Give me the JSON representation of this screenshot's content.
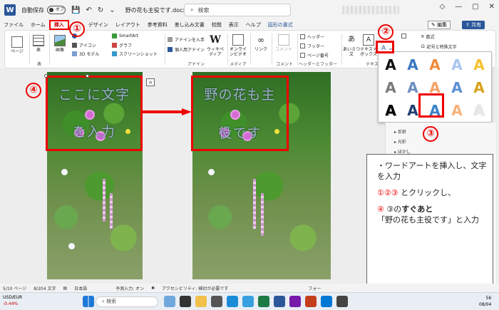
{
  "titlebar": {
    "autosave_label": "自動保存",
    "autosave_state": "オフ",
    "doc_title": "野の花も主役です.docx",
    "search_placeholder": "検索"
  },
  "menu": {
    "items": [
      "ファイル",
      "ホーム",
      "挿入",
      "デザイン",
      "レイアウト",
      "参考資料",
      "差し込み文書",
      "校閲",
      "表示",
      "ヘルプ",
      "図形の書式"
    ],
    "active_index": 2,
    "edit_label": "編集",
    "share_label": "共有"
  },
  "ribbon": {
    "pages": "ページ",
    "table": "表",
    "image": "画像",
    "icon": "アイコン",
    "model3d": "3D モデル",
    "smartart": "SmartArt",
    "graph": "グラフ",
    "screenshot": "スクリーンショット",
    "addin_get": "アドインを入手",
    "personal_addin": "個人用アドイン",
    "wikipedia": "ウィキペディア",
    "online_video": "オンラインビデオ",
    "link": "リンク",
    "comment": "コメント",
    "header": "ヘッダー",
    "footer": "フッター",
    "page_number": "ページ番号",
    "textbox": "テキストボックス",
    "aiueo": "あいさつ文",
    "equation": "数式",
    "symbol": "記号と特殊文字",
    "groups": {
      "table": "表",
      "addin": "アドイン",
      "media": "メディア",
      "comment": "コメント",
      "headerfooter": "ヘッダーとフッター",
      "text": "テキスト"
    }
  },
  "document": {
    "left_wordart_line1": "ここに文字",
    "left_wordart_line2": "を入力",
    "right_wordart_line1": "野の花も主",
    "right_wordart_line2": "役です"
  },
  "badges": [
    "①",
    "②",
    "③",
    "④"
  ],
  "gallery": {
    "glyph": "A",
    "selected_row": 2,
    "selected_col": 2,
    "colors": [
      [
        "#111111",
        "#3b78c4",
        "#f08a3c",
        "#a8c6ee",
        "#f5c12e"
      ],
      [
        "#7a7a7a",
        "#6d8fbf",
        "#f4a46a",
        "#5b8fd6",
        "#d9a21c"
      ],
      [
        "#000000",
        "#1f3f73",
        "#3a82c9",
        "#f7b27a",
        "#e8e8e8"
      ]
    ]
  },
  "pane": {
    "items": [
      "反射",
      "光彩",
      "ぼかし"
    ]
  },
  "note": {
    "line1": "・ワードアートを挿入し、文字を入力",
    "line2_red": "①②③",
    "line2_rest": " とクリックし、",
    "line3_red": "④",
    "line3_mid": " ③の",
    "line3_bold": "すぐあと",
    "line4": "「野の花も主役です」と入力"
  },
  "status": {
    "page": "5/10 ページ",
    "words": "8/204 文字",
    "lang": "日本語",
    "predict": "予測入力: オン",
    "access": "アクセシビリティ: 検討が必要です",
    "focus": "フォー"
  },
  "taskbar": {
    "stock_name": "USD/EUR",
    "stock_change": "-0.44%",
    "search_label": "検索",
    "time": "56",
    "date": "08/04"
  }
}
